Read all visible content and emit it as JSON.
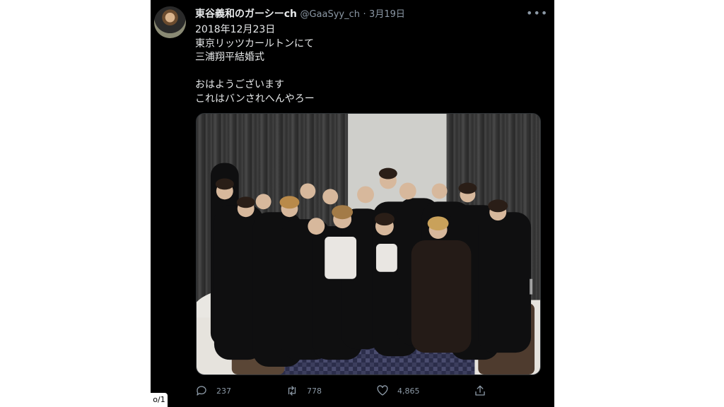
{
  "tweet": {
    "author": "東谷義和のガーシーch",
    "handle": "@GaaSyy_ch",
    "separator": "·",
    "date": "3月19日",
    "more_icon": "more-horizontal-icon",
    "lines": [
      "2018年12月23日",
      "東京リッツカールトンにて",
      "三浦翔平結婚式",
      "",
      "おはようございます",
      "これはバンされへんやろー"
    ]
  },
  "actions": {
    "reply": {
      "icon": "reply-icon",
      "count": "237"
    },
    "retweet": {
      "icon": "retweet-icon",
      "count": "778"
    },
    "like": {
      "icon": "heart-icon",
      "count": "4,865"
    },
    "share": {
      "icon": "share-icon"
    }
  },
  "pager": {
    "label": "o/1"
  },
  "colors": {
    "background": "#000000",
    "text": "#e7e9ea",
    "muted": "#8b98a5"
  }
}
